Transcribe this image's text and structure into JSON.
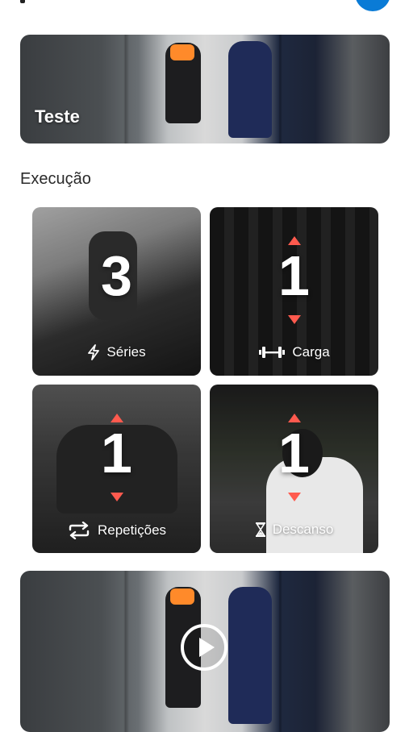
{
  "banner": {
    "title": "Teste"
  },
  "section": {
    "title": "Execução"
  },
  "tiles": [
    {
      "value": "3",
      "label": "Séries",
      "icon": "lightning-icon"
    },
    {
      "value": "1",
      "label": "Carga",
      "icon": "dumbbell-icon"
    },
    {
      "value": "1",
      "label": "Repetições",
      "icon": "repeat-icon"
    },
    {
      "value": "1",
      "label": "Descanso",
      "icon": "hourglass-icon"
    }
  ],
  "colors": {
    "accent": "#0a7bd6",
    "arrow": "#ff5a4e"
  }
}
